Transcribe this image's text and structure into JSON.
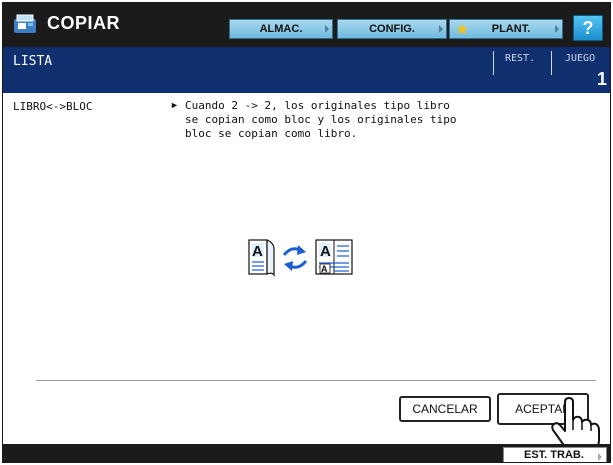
{
  "app": {
    "title": "COPIAR",
    "icon": "copier-icon"
  },
  "toolbar": {
    "almac_label": "ALMAC.",
    "config_label": "CONFIG.",
    "plant_label": "PLANT.",
    "help_label": "?"
  },
  "header": {
    "title": "LISTA",
    "rest_label": "REST.",
    "juego_label": "JUEGO",
    "juego_value": "1"
  },
  "main": {
    "item_label": "LIBRO<->BLOC",
    "bullet": "►",
    "description": "Cuando 2 -> 2, los originales tipo libro\nse copian como bloc y los originales tipo\nbloc se copian como libro.",
    "illustration": {
      "doc_letter": "A",
      "icon": "book-bloc-swap-icon"
    }
  },
  "buttons": {
    "cancel": "CANCELAR",
    "accept": "ACEPTAR"
  },
  "footer": {
    "est_trab_label": "EST. TRAB."
  },
  "colors": {
    "topbar": "#1b1b1b",
    "header": "#0f2f6e",
    "toolbar_button": "#6fbbe0",
    "help_button": "#1a8fd0",
    "swap_arrows": "#1a5fd0"
  }
}
